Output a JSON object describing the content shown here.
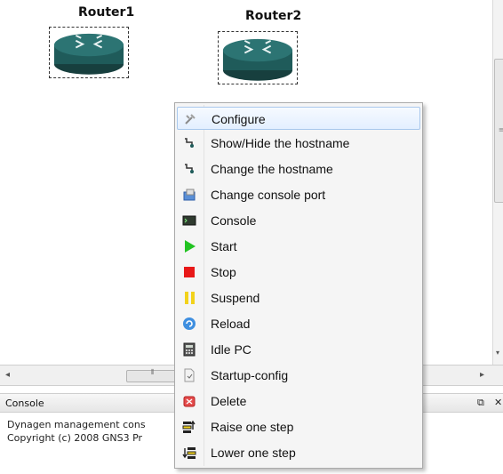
{
  "routers": [
    {
      "label": "Router1"
    },
    {
      "label": "Router2"
    }
  ],
  "context_menu": {
    "items": [
      {
        "label": "Configure",
        "icon": "wrench-icon"
      },
      {
        "label": "Show/Hide the hostname",
        "icon": "router-tag-icon"
      },
      {
        "label": "Change the hostname",
        "icon": "router-tag-icon"
      },
      {
        "label": "Change console port",
        "icon": "console-port-icon"
      },
      {
        "label": "Console",
        "icon": "terminal-icon"
      },
      {
        "label": "Start",
        "icon": "play-icon"
      },
      {
        "label": "Stop",
        "icon": "stop-icon"
      },
      {
        "label": "Suspend",
        "icon": "pause-icon"
      },
      {
        "label": "Reload",
        "icon": "reload-icon"
      },
      {
        "label": "Idle PC",
        "icon": "calculator-icon"
      },
      {
        "label": "Startup-config",
        "icon": "document-icon"
      },
      {
        "label": "Delete",
        "icon": "delete-icon"
      },
      {
        "label": "Raise one step",
        "icon": "raise-icon"
      },
      {
        "label": "Lower one step",
        "icon": "lower-icon"
      }
    ]
  },
  "console": {
    "title": "Console",
    "line1": "Dynagen management cons",
    "line2": "Copyright (c) 2008 GNS3 Pr"
  },
  "colors": {
    "router_teal": "#1f5b5a",
    "menu_highlight": "#e3efff",
    "start_green": "#22c322",
    "stop_red": "#e81818",
    "suspend_yellow": "#f2d21b"
  }
}
